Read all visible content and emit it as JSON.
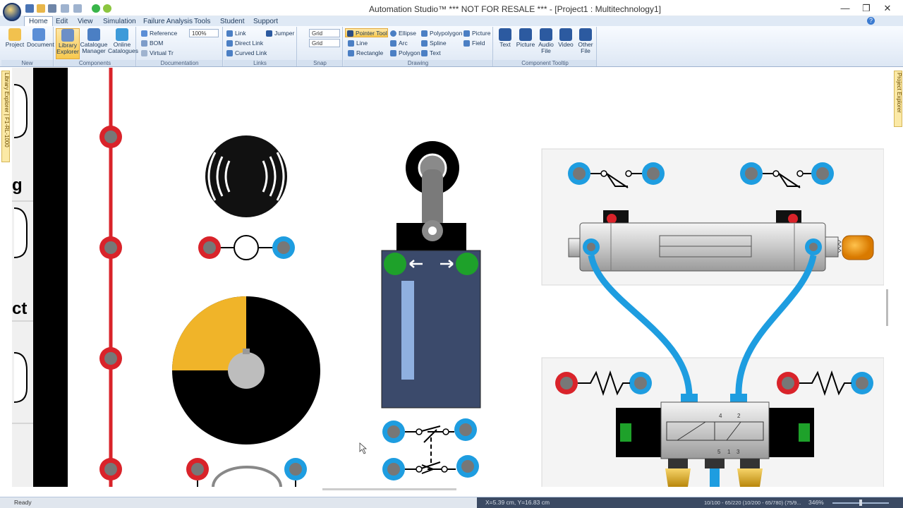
{
  "app": {
    "title": "Automation Studio™   *** NOT FOR RESALE ***   - [Project1 : Multitechnology1]",
    "help_glyph": "?"
  },
  "window_buttons": {
    "minimize": "—",
    "maximize": "❐",
    "close": "✕"
  },
  "tabs": [
    "Home",
    "Edit",
    "View",
    "Simulation",
    "Failure Analysis",
    "Tools",
    "Student",
    "Support"
  ],
  "ribbon": {
    "new": {
      "title": "New",
      "project": "Project",
      "document": "Document"
    },
    "components": {
      "title": "Components",
      "library_explorer": "Library Explorer",
      "catalogue_manager": "Catalogue Manager",
      "online_catalogues": "Online Catalogues"
    },
    "documentation": {
      "title": "Documentation",
      "reference": "Reference",
      "bom": "BOM",
      "virtual": "Virtual Tr",
      "zoom": "100%"
    },
    "links": {
      "title": "Links",
      "link": "Link",
      "direct_link": "Direct Link",
      "curved_link": "Curved Link",
      "jumper": "Jumper"
    },
    "snap": {
      "title": "Snap",
      "grid1": "Grid",
      "grid2": "Grid"
    },
    "drawing": {
      "title": "Drawing",
      "pointer_tool": "Pointer Tool",
      "line": "Line",
      "rectangle": "Rectangle",
      "ellipse": "Ellipse",
      "arc": "Arc",
      "polygon": "Polygon",
      "polypolygon": "Polypolygon",
      "spline": "Spline",
      "text": "Text",
      "picture": "Picture",
      "field": "Field"
    },
    "tooltip": {
      "title": "Component Tooltip",
      "text": "Text",
      "picture": "Picture",
      "audio_file": "Audio File",
      "video": "Video",
      "other_file": "Other File"
    }
  },
  "side": {
    "left_tab": "Library Explorer | F1-RL-1000",
    "right_tab": "Project Explorer"
  },
  "library_labels": {
    "item1": "g",
    "item2": "ct"
  },
  "status": {
    "ready": "Ready",
    "coords": "X=5.39 cm, Y=16.83 cm",
    "page": "10/100 - 65/220 (10/200 - 65/780) (75/9...",
    "zoom": "346%"
  },
  "colors": {
    "accent": "#2b579a",
    "red_port": "#d9232a",
    "blue_port": "#1e9de0",
    "cylinder_blue": "#3b4a6b",
    "green_led": "#1ea12a",
    "yellow_sector": "#f0b429"
  }
}
